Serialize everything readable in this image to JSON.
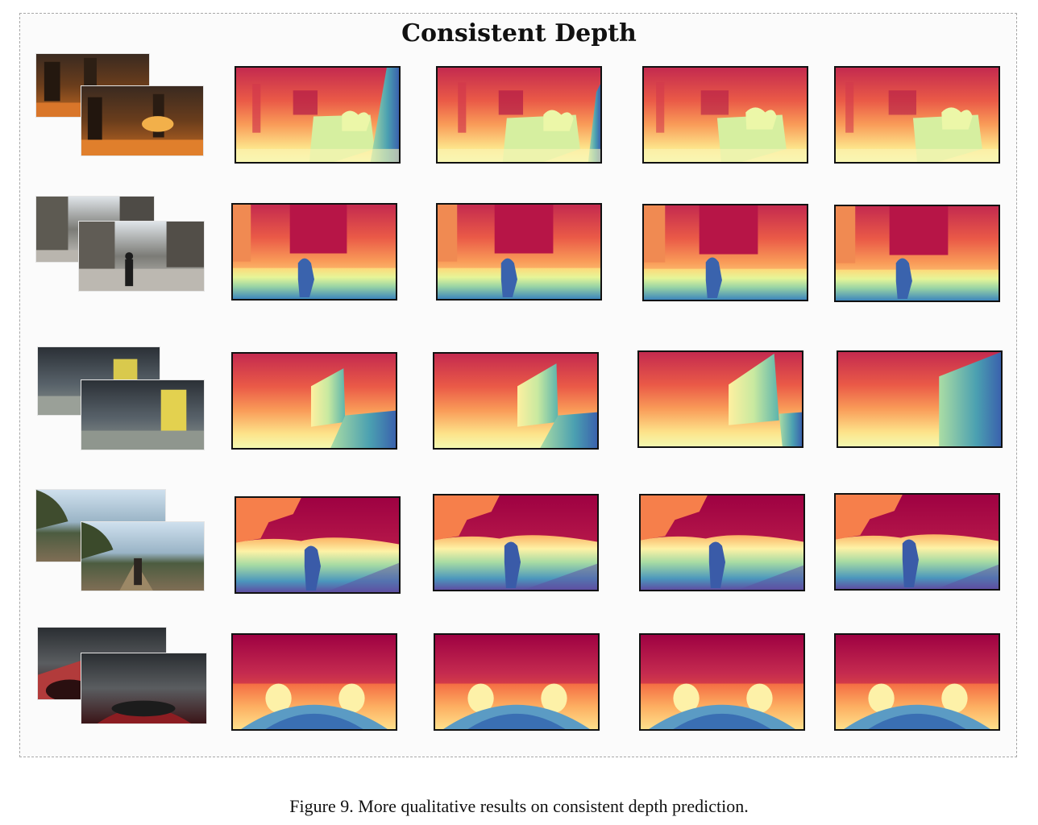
{
  "figure": {
    "title": "Consistent Depth",
    "caption": "Figure 9. More qualitative results on consistent depth prediction."
  },
  "rows": [
    {
      "scene": "indoor-hall"
    },
    {
      "scene": "city-street"
    },
    {
      "scene": "neon-corridor"
    },
    {
      "scene": "forest-trail"
    },
    {
      "scene": "racing-cockpit"
    }
  ],
  "colors": {
    "near": "#5e4fa2",
    "far": "#9e0142",
    "border": "#111111",
    "frame_dash": "#a8a8a8"
  }
}
